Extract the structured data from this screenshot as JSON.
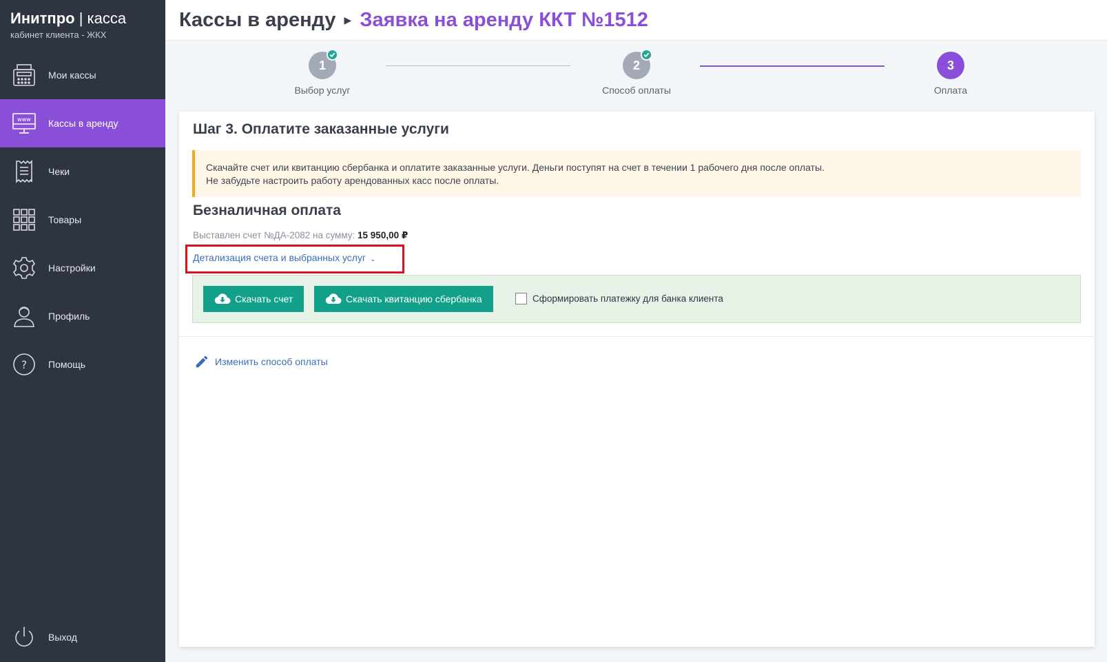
{
  "brand": {
    "title_bold": "Инитпро",
    "separator": "|",
    "title_thin": "касса",
    "subtitle": "кабинет клиента - ЖКХ"
  },
  "sidebar": {
    "items": [
      {
        "label": "Мои кассы",
        "icon": "cash-register-icon"
      },
      {
        "label": "Кассы в аренду",
        "icon": "www-monitor-icon"
      },
      {
        "label": "Чеки",
        "icon": "receipt-icon"
      },
      {
        "label": "Товары",
        "icon": "grid-icon"
      },
      {
        "label": "Настройки",
        "icon": "gear-icon"
      },
      {
        "label": "Профиль",
        "icon": "user-icon"
      },
      {
        "label": "Помощь",
        "icon": "help-icon"
      }
    ],
    "logout": {
      "label": "Выход",
      "icon": "power-icon"
    }
  },
  "header": {
    "crumb1": "Кассы в аренду",
    "separator": "›",
    "crumb2": "Заявка на аренду ККТ №1512"
  },
  "stepper": {
    "steps": [
      {
        "number": "1",
        "label": "Выбор услуг",
        "completed": true
      },
      {
        "number": "2",
        "label": "Способ оплаты",
        "completed": true
      },
      {
        "number": "3",
        "label": "Оплата",
        "completed": false
      }
    ]
  },
  "main": {
    "title": "Шаг 3. Оплатите заказанные услуги",
    "notice_line1": "Скачайте счет или квитанцию сбербанка и оплатите заказанные услуги. Деньги поступят на счет в течении 1 рабочего дня после оплаты.",
    "notice_line2": "Не забудьте настроить работу арендованных касс после оплаты.",
    "section_title": "Безналичная оплата",
    "invoice_prefix": "Выставлен счет №ДА-2082 на сумму:",
    "invoice_amount": "15 950,00 ₽",
    "detail_link": "Детализация счета и выбранных услуг",
    "download_invoice": "Скачать счет",
    "download_receipt": "Скачать квитанцию сбербанка",
    "checkbox_label": "Сформировать платежку для банка клиента",
    "change_payment": "Изменить способ оплаты"
  },
  "colors": {
    "accent": "#8a4fd8",
    "sidebar": "#2e3441",
    "button": "#13a08a",
    "link": "#3a6db8",
    "highlight": "#e0101e"
  }
}
